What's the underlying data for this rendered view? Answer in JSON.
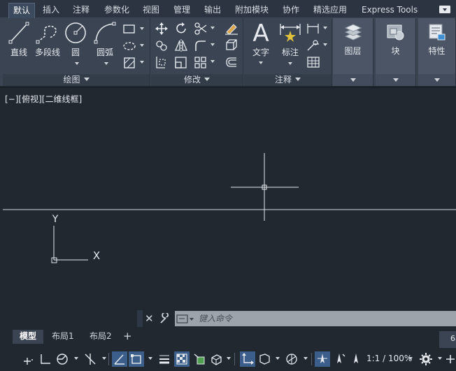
{
  "ribbon_tabs": [
    "默认",
    "插入",
    "注释",
    "参数化",
    "视图",
    "管理",
    "输出",
    "附加模块",
    "协作",
    "精选应用",
    "Express Tools"
  ],
  "draw_panel": {
    "title": "绘图",
    "line": "直线",
    "polyline": "多段线",
    "circle": "圆",
    "arc": "圆弧"
  },
  "modify_panel": {
    "title": "修改"
  },
  "annotation_panel": {
    "title": "注释",
    "text": "文字",
    "dimension": "标注"
  },
  "layers_label": "图层",
  "block_label": "块",
  "properties_label": "特性",
  "viewport_label": "[−][俯视][二维线框]",
  "ucs": {
    "y_axis": "Y",
    "x_axis": "X"
  },
  "command_line": {
    "placeholder": "键入命令"
  },
  "layout_tabs": [
    "模型",
    "布局1",
    "布局2"
  ],
  "coordinate_readout": "6",
  "status_bar": {
    "annotation_scale": "1:1 / 100%"
  },
  "colors": {
    "canvas": "#212830",
    "ribbon": "#3b4453",
    "accent": "#3c5e8a"
  }
}
